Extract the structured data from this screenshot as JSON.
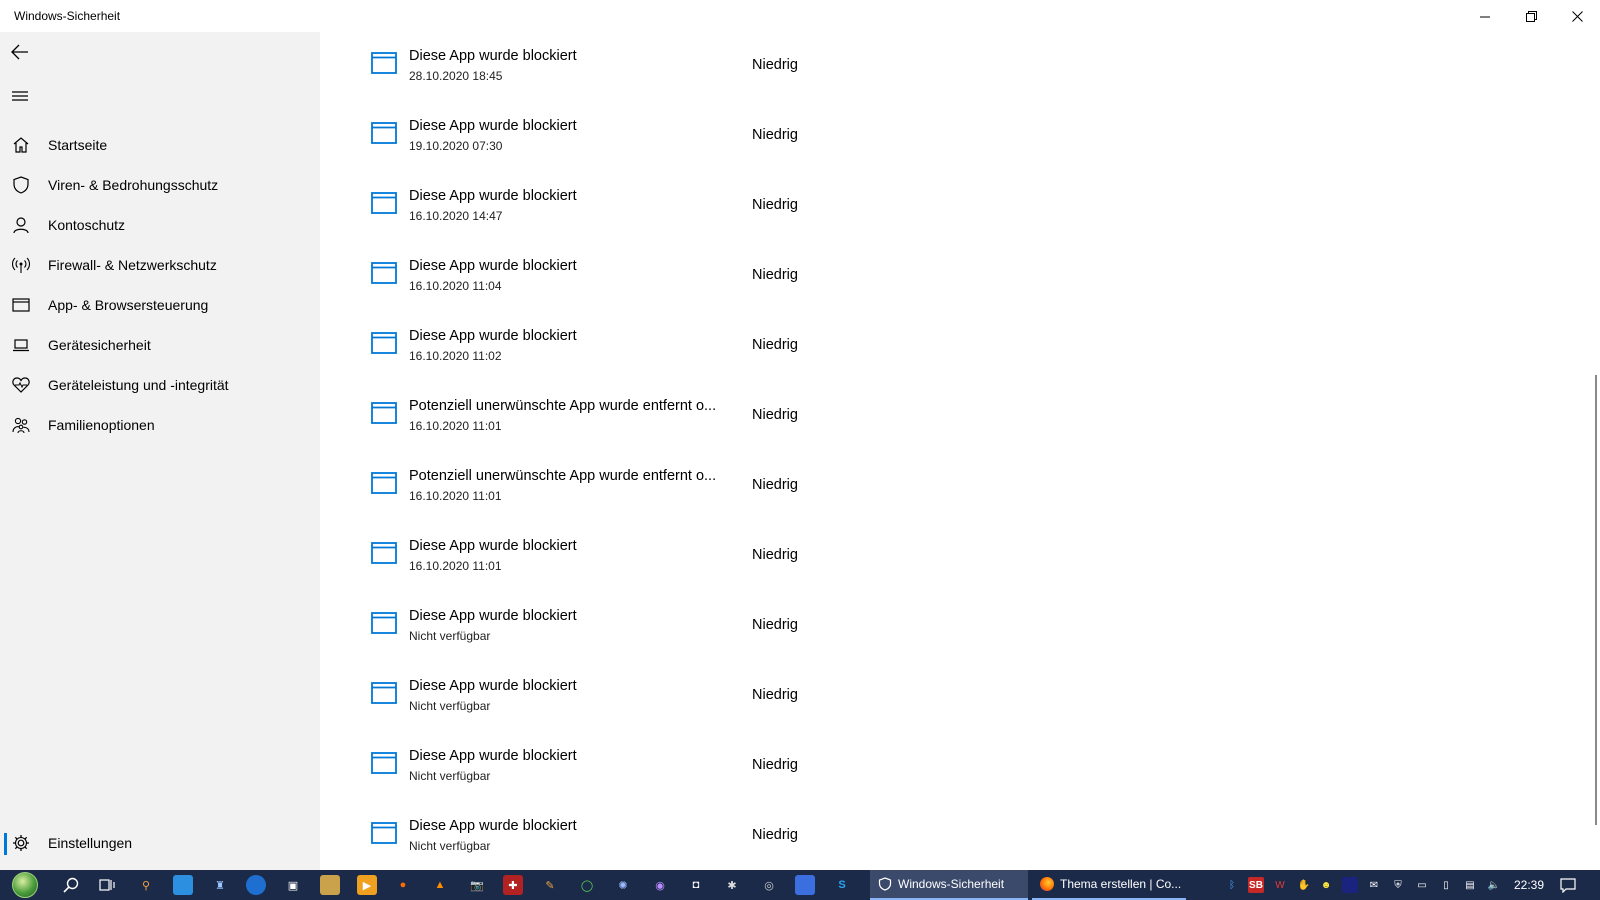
{
  "window": {
    "title": "Windows-Sicherheit",
    "minimize_icon": "minimize-icon",
    "maximize_icon": "restore-icon",
    "close_icon": "close-icon"
  },
  "sidebar": {
    "back_icon": "back-arrow-icon",
    "menu_icon": "hamburger-menu-icon",
    "items": [
      {
        "label": "Startseite",
        "icon": "home-icon"
      },
      {
        "label": "Viren- & Bedrohungsschutz",
        "icon": "shield-icon"
      },
      {
        "label": "Kontoschutz",
        "icon": "person-icon"
      },
      {
        "label": "Firewall- & Netzwerkschutz",
        "icon": "antenna-icon"
      },
      {
        "label": "App- & Browsersteuerung",
        "icon": "browser-window-icon"
      },
      {
        "label": "Gerätesicherheit",
        "icon": "laptop-icon"
      },
      {
        "label": "Geräteleistung und -integrität",
        "icon": "heart-icon"
      },
      {
        "label": "Familienoptionen",
        "icon": "family-icon"
      }
    ],
    "settings": {
      "label": "Einstellungen",
      "icon": "gear-icon"
    }
  },
  "history": [
    {
      "title": "Diese App wurde blockiert",
      "date": "28.10.2020 18:45",
      "severity": "Niedrig"
    },
    {
      "title": "Diese App wurde blockiert",
      "date": "19.10.2020 07:30",
      "severity": "Niedrig"
    },
    {
      "title": "Diese App wurde blockiert",
      "date": "16.10.2020 14:47",
      "severity": "Niedrig"
    },
    {
      "title": "Diese App wurde blockiert",
      "date": "16.10.2020 11:04",
      "severity": "Niedrig"
    },
    {
      "title": "Diese App wurde blockiert",
      "date": "16.10.2020 11:02",
      "severity": "Niedrig"
    },
    {
      "title": "Potenziell unerwünschte App wurde entfernt o...",
      "date": "16.10.2020 11:01",
      "severity": "Niedrig"
    },
    {
      "title": "Potenziell unerwünschte App wurde entfernt o...",
      "date": "16.10.2020 11:01",
      "severity": "Niedrig"
    },
    {
      "title": "Diese App wurde blockiert",
      "date": "16.10.2020 11:01",
      "severity": "Niedrig"
    },
    {
      "title": "Diese App wurde blockiert",
      "date": "Nicht verfügbar",
      "severity": "Niedrig"
    },
    {
      "title": "Diese App wurde blockiert",
      "date": "Nicht verfügbar",
      "severity": "Niedrig"
    },
    {
      "title": "Diese App wurde blockiert",
      "date": "Nicht verfügbar",
      "severity": "Niedrig"
    },
    {
      "title": "Diese App wurde blockiert",
      "date": "Nicht verfügbar",
      "severity": "Niedrig"
    }
  ],
  "taskbar": {
    "tasks": [
      {
        "label": "Windows-Sicherheit",
        "icon": "shield-icon"
      },
      {
        "label": "Thema erstellen | Co...",
        "icon": "firefox-icon"
      }
    ],
    "tray_icons": [
      {
        "name": "sb-tray-icon",
        "text": "SB"
      }
    ],
    "clock": "22:39"
  },
  "colors": {
    "accent": "#0078d7",
    "sidebar_bg": "#f2f2f2",
    "taskbar_bg": "#1c2a4a"
  }
}
